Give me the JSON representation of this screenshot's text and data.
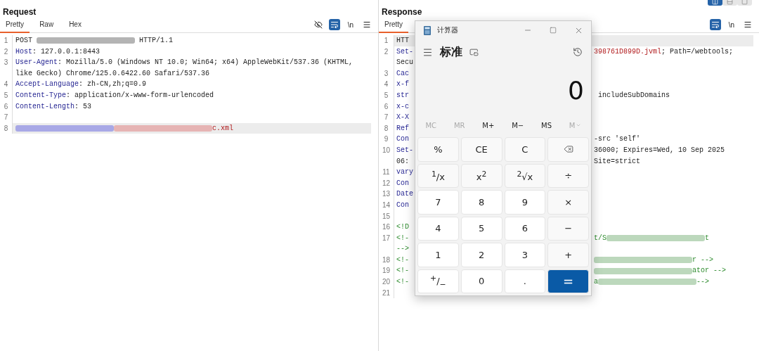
{
  "request": {
    "title": "Request",
    "tabs": [
      {
        "label": "Pretty",
        "selected": true
      },
      {
        "label": "Raw",
        "selected": false
      },
      {
        "label": "Hex",
        "selected": false
      }
    ],
    "tools": [
      {
        "kind": "eye-off",
        "selected": false
      },
      {
        "kind": "wrap",
        "selected": true
      },
      {
        "kind": "text",
        "label": "\\n",
        "selected": false
      },
      {
        "kind": "menu",
        "selected": false
      }
    ],
    "lines": [
      {
        "n": "1",
        "highlighted": false,
        "rows": [
          [
            {
              "kind": "plain",
              "text": "POST "
            },
            {
              "kind": "redacted",
              "color": "#b4b4b4"
            },
            {
              "kind": "plain",
              "text": " HTTP/1.1"
            }
          ]
        ]
      },
      {
        "n": "2",
        "highlighted": false,
        "rows": [
          [
            {
              "kind": "key",
              "text": "Host"
            },
            {
              "kind": "plain",
              "text": ": 127.0.0.1:8443"
            }
          ]
        ]
      },
      {
        "n": "3",
        "highlighted": false,
        "rows": [
          [
            {
              "kind": "key",
              "text": "User-Agent"
            },
            {
              "kind": "plain",
              "text": ": Mozilla/5.0 (Windows NT 10.0; Win64; x64) AppleWebKit/537.36 (KHTML,"
            }
          ],
          [
            {
              "kind": "plain",
              "text": "like Gecko) Chrome/125.0.6422.60 Safari/537.36"
            }
          ]
        ]
      },
      {
        "n": "4",
        "highlighted": false,
        "rows": [
          [
            {
              "kind": "key",
              "text": "Accept-Language"
            },
            {
              "kind": "plain",
              "text": ": zh-CN,zh;q=0.9"
            }
          ]
        ]
      },
      {
        "n": "5",
        "highlighted": false,
        "rows": [
          [
            {
              "kind": "key",
              "text": "Content-Type"
            },
            {
              "kind": "plain",
              "text": ": application/x-www-form-urlencoded"
            }
          ]
        ]
      },
      {
        "n": "6",
        "highlighted": false,
        "rows": [
          [
            {
              "kind": "key",
              "text": "Content-Length"
            },
            {
              "kind": "plain",
              "text": ": 53"
            }
          ]
        ]
      },
      {
        "n": "7",
        "highlighted": false,
        "rows": [
          []
        ]
      },
      {
        "n": "8",
        "highlighted": true,
        "rows": [
          [
            {
              "kind": "redacted",
              "color": "#a8a8e6"
            },
            {
              "kind": "redacted",
              "color": "#e6b4b4"
            },
            {
              "kind": "string",
              "text": "c.xml"
            }
          ]
        ]
      }
    ]
  },
  "response": {
    "title": "Response",
    "view_buttons": [
      {
        "selected": true
      },
      {
        "selected": false
      },
      {
        "selected": false
      }
    ],
    "tabs": [
      {
        "label": "Pretty",
        "selected": true
      }
    ],
    "tools": [
      {
        "kind": "wrap",
        "selected": true
      },
      {
        "kind": "text",
        "label": "\\n",
        "selected": false
      },
      {
        "kind": "menu",
        "selected": false
      }
    ],
    "lines": [
      {
        "n": "1",
        "highlighted": true,
        "rows": [
          {
            "left": [
              {
                "kind": "plain",
                "text": "HTT"
              }
            ],
            "right": []
          }
        ]
      },
      {
        "n": "2",
        "highlighted": false,
        "rows": [
          {
            "left": [
              {
                "kind": "key",
                "text": "Set-"
              }
            ],
            "right": [
              {
                "kind": "string",
                "text": "398761D899D.jvml"
              },
              {
                "kind": "plain",
                "text": "; Path=/webtools;"
              }
            ]
          },
          {
            "left": [
              {
                "kind": "plain",
                "text": "Secu"
              }
            ],
            "right": []
          }
        ]
      },
      {
        "n": "3",
        "highlighted": false,
        "rows": [
          {
            "left": [
              {
                "kind": "key",
                "text": "Cac"
              }
            ],
            "right": []
          }
        ]
      },
      {
        "n": "4",
        "highlighted": false,
        "rows": [
          {
            "left": [
              {
                "kind": "key",
                "text": "x-f"
              }
            ],
            "right": []
          }
        ]
      },
      {
        "n": "5",
        "highlighted": false,
        "rows": [
          {
            "left": [
              {
                "kind": "key",
                "text": "str"
              }
            ],
            "right": [
              {
                "kind": "plain",
                "text": " includeSubDomains"
              }
            ]
          }
        ]
      },
      {
        "n": "6",
        "highlighted": false,
        "rows": [
          {
            "left": [
              {
                "kind": "key",
                "text": "x-c"
              }
            ],
            "right": []
          }
        ]
      },
      {
        "n": "7",
        "highlighted": false,
        "rows": [
          {
            "left": [
              {
                "kind": "key",
                "text": "X-X"
              }
            ],
            "right": []
          }
        ]
      },
      {
        "n": "8",
        "highlighted": false,
        "rows": [
          {
            "left": [
              {
                "kind": "key",
                "text": "Ref"
              }
            ],
            "right": []
          }
        ]
      },
      {
        "n": "9",
        "highlighted": false,
        "rows": [
          {
            "left": [
              {
                "kind": "key",
                "text": "Con"
              }
            ],
            "right": [
              {
                "kind": "plain",
                "text": "-src 'self'"
              }
            ]
          }
        ]
      },
      {
        "n": "10",
        "highlighted": false,
        "rows": [
          {
            "left": [
              {
                "kind": "key",
                "text": "Set-"
              }
            ],
            "right": [
              {
                "kind": "plain",
                "text": "36000; Expires=Wed, 10 Sep 2025"
              }
            ]
          },
          {
            "left": [
              {
                "kind": "plain",
                "text": "06:"
              }
            ],
            "right": [
              {
                "kind": "plain",
                "text": "Site=strict"
              }
            ]
          }
        ]
      },
      {
        "n": "11",
        "highlighted": false,
        "rows": [
          {
            "left": [
              {
                "kind": "key",
                "text": "vary"
              }
            ],
            "right": []
          }
        ]
      },
      {
        "n": "12",
        "highlighted": false,
        "rows": [
          {
            "left": [
              {
                "kind": "key",
                "text": "Con"
              }
            ],
            "right": []
          }
        ]
      },
      {
        "n": "13",
        "highlighted": false,
        "rows": [
          {
            "left": [
              {
                "kind": "key",
                "text": "Date"
              }
            ],
            "right": []
          }
        ]
      },
      {
        "n": "14",
        "highlighted": false,
        "rows": [
          {
            "left": [
              {
                "kind": "key",
                "text": "Con"
              }
            ],
            "right": []
          }
        ]
      },
      {
        "n": "15",
        "highlighted": false,
        "rows": [
          {
            "left": [],
            "right": []
          }
        ]
      },
      {
        "n": "16",
        "highlighted": false,
        "rows": [
          {
            "left": [
              {
                "kind": "comment",
                "text": "<!D"
              }
            ],
            "right": []
          }
        ]
      },
      {
        "n": "17",
        "highlighted": false,
        "rows": [
          {
            "left": [
              {
                "kind": "comment",
                "text": "<!-"
              }
            ],
            "right": [
              {
                "kind": "comment",
                "text": "t/S"
              },
              {
                "kind": "redacted",
                "color": "#bcd8bc"
              },
              {
                "kind": "comment",
                "text": "t"
              }
            ]
          },
          {
            "left": [
              {
                "kind": "comment",
                "text": "-->"
              }
            ],
            "right": []
          }
        ]
      },
      {
        "n": "18",
        "highlighted": false,
        "rows": [
          {
            "left": [
              {
                "kind": "comment",
                "text": "<!-"
              }
            ],
            "right": [
              {
                "kind": "redacted",
                "color": "#bcd8bc"
              },
              {
                "kind": "comment",
                "text": "r -->"
              }
            ]
          }
        ]
      },
      {
        "n": "19",
        "highlighted": false,
        "rows": [
          {
            "left": [
              {
                "kind": "comment",
                "text": "<!-"
              }
            ],
            "right": [
              {
                "kind": "redacted",
                "color": "#bcd8bc"
              },
              {
                "kind": "comment",
                "text": "ator -->"
              }
            ]
          }
        ]
      },
      {
        "n": "20",
        "highlighted": false,
        "rows": [
          {
            "left": [
              {
                "kind": "comment",
                "text": "<!-"
              }
            ],
            "right": [
              {
                "kind": "comment",
                "text": "a"
              },
              {
                "kind": "redacted",
                "color": "#bcd8bc"
              },
              {
                "kind": "comment",
                "text": "-->"
              }
            ]
          }
        ]
      },
      {
        "n": "21",
        "highlighted": false,
        "rows": [
          {
            "left": [],
            "right": []
          }
        ]
      }
    ]
  },
  "calculator": {
    "title": "计算器",
    "mode": "标准",
    "display": "0",
    "memory": [
      {
        "label": "MC",
        "kind": "button",
        "disabled": true
      },
      {
        "label": "MR",
        "kind": "button",
        "disabled": true
      },
      {
        "label": "M+",
        "kind": "button",
        "disabled": false
      },
      {
        "label": "M−",
        "kind": "button",
        "disabled": false
      },
      {
        "label": "MS",
        "kind": "button",
        "disabled": false
      },
      {
        "label": "M",
        "kind": "dropdown",
        "disabled": true
      }
    ],
    "keys": [
      {
        "kind": "function",
        "label": "%"
      },
      {
        "kind": "function",
        "label": "CE"
      },
      {
        "kind": "function",
        "label": "C"
      },
      {
        "kind": "backspace"
      },
      {
        "kind": "function",
        "label": "$^{1}$/x"
      },
      {
        "kind": "function",
        "label": "x$^{2}$"
      },
      {
        "kind": "function",
        "label": "$^{2}$√x"
      },
      {
        "kind": "function",
        "label": "÷"
      },
      {
        "kind": "digit",
        "label": "7"
      },
      {
        "kind": "digit",
        "label": "8"
      },
      {
        "kind": "digit",
        "label": "9"
      },
      {
        "kind": "function",
        "label": "×"
      },
      {
        "kind": "digit",
        "label": "4"
      },
      {
        "kind": "digit",
        "label": "5"
      },
      {
        "kind": "digit",
        "label": "6"
      },
      {
        "kind": "function",
        "label": "−"
      },
      {
        "kind": "digit",
        "label": "1"
      },
      {
        "kind": "digit",
        "label": "2"
      },
      {
        "kind": "digit",
        "label": "3"
      },
      {
        "kind": "function",
        "label": "+"
      },
      {
        "kind": "digit",
        "label": "$^{+}$/$_{−}$"
      },
      {
        "kind": "digit",
        "label": "0"
      },
      {
        "kind": "digit",
        "label": "."
      },
      {
        "kind": "equals",
        "label": "="
      }
    ]
  }
}
